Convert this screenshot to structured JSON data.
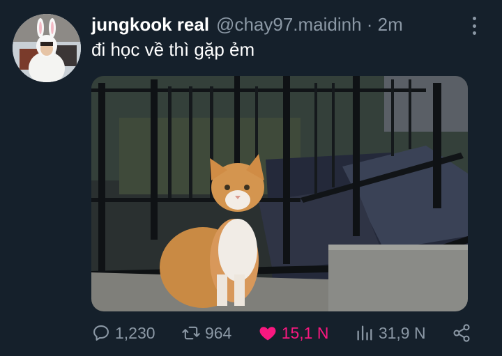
{
  "tweet": {
    "display_name": "jungkook real",
    "handle_time": "@chay97.maidinh · 2m",
    "text": "đi học về thì gặp ẻm",
    "avatar_icon": "profile-avatar",
    "media_alt_icon": "cat-photo"
  },
  "actions": {
    "reply_count": "1,230",
    "retweet_count": "964",
    "like_count": "15,1 N",
    "view_count": "31,9 N"
  },
  "colors": {
    "background": "#15202b",
    "secondary_text": "#8b98a5",
    "like": "#f91880"
  }
}
